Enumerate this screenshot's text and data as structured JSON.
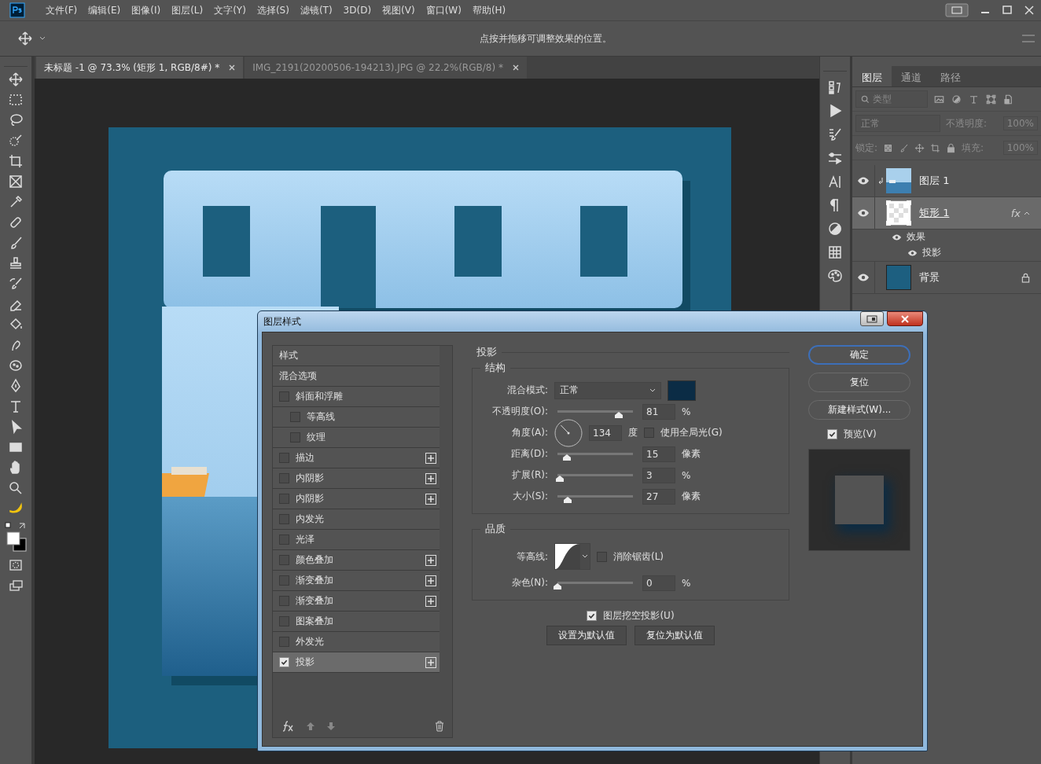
{
  "menu_bar": {
    "items": [
      "文件(F)",
      "编辑(E)",
      "图像(I)",
      "图层(L)",
      "文字(Y)",
      "选择(S)",
      "滤镜(T)",
      "3D(D)",
      "视图(V)",
      "窗口(W)",
      "帮助(H)"
    ]
  },
  "options_bar": {
    "hint": "点按并拖移可调整效果的位置。"
  },
  "document_tabs": [
    {
      "label": "未标题 -1 @ 73.3% (矩形 1, RGB/8#) *",
      "selected": true
    },
    {
      "label": "IMG_2191(20200506-194213).JPG @ 22.2%(RGB/8) *",
      "selected": false
    }
  ],
  "layers_panel": {
    "tabs": [
      {
        "label": "图层",
        "selected": true
      },
      {
        "label": "通道",
        "selected": false
      },
      {
        "label": "路径",
        "selected": false
      }
    ],
    "filter": "类型",
    "blend_mode": "正常",
    "opacity_label": "不透明度:",
    "opacity": "100%",
    "lock_label": "锁定:",
    "fill_label": "填充:",
    "fill": "100%",
    "layers": [
      {
        "name": "图层 1",
        "visible": true,
        "selected": false,
        "clipped": true,
        "locked": false
      },
      {
        "name": "矩形 1",
        "kind": "shape",
        "visible": true,
        "selected": true,
        "clipped": false,
        "locked": false,
        "fx": "fx",
        "effects": {
          "label": "效果",
          "items": [
            "投影"
          ]
        }
      },
      {
        "name": "背景",
        "kind": "solid",
        "visible": true,
        "selected": false,
        "clipped": false,
        "locked": true
      }
    ]
  },
  "layer_style_dialog": {
    "title": "图层样式",
    "styles": [
      {
        "label": "样式",
        "kind": "header",
        "selected": false
      },
      {
        "label": "混合选项",
        "kind": "header",
        "selected": false
      },
      {
        "label": "斜面和浮雕",
        "kind": "checkbox",
        "checked": false,
        "selected": false,
        "addable": false,
        "children": [
          {
            "label": "等高线",
            "kind": "checkbox",
            "checked": false,
            "selected": false,
            "addable": false
          },
          {
            "label": "纹理",
            "kind": "checkbox",
            "checked": false,
            "selected": false,
            "addable": false
          }
        ]
      },
      {
        "label": "描边",
        "kind": "checkbox",
        "checked": false,
        "selected": false,
        "addable": true
      },
      {
        "label": "内阴影",
        "kind": "checkbox",
        "checked": false,
        "selected": false,
        "addable": true
      },
      {
        "label": "内阴影",
        "kind": "checkbox",
        "checked": false,
        "selected": false,
        "addable": true
      },
      {
        "label": "内发光",
        "kind": "checkbox",
        "checked": false,
        "selected": false,
        "addable": false
      },
      {
        "label": "光泽",
        "kind": "checkbox",
        "checked": false,
        "selected": false,
        "addable": false
      },
      {
        "label": "颜色叠加",
        "kind": "checkbox",
        "checked": false,
        "selected": false,
        "addable": true
      },
      {
        "label": "渐变叠加",
        "kind": "checkbox",
        "checked": false,
        "selected": false,
        "addable": true
      },
      {
        "label": "渐变叠加",
        "kind": "checkbox",
        "checked": false,
        "selected": false,
        "addable": true
      },
      {
        "label": "图案叠加",
        "kind": "checkbox",
        "checked": false,
        "selected": false,
        "addable": false
      },
      {
        "label": "外发光",
        "kind": "checkbox",
        "checked": false,
        "selected": false,
        "addable": false
      },
      {
        "label": "投影",
        "kind": "checkbox",
        "checked": true,
        "selected": true,
        "addable": true
      }
    ],
    "section_title": "投影",
    "structure": {
      "title": "结构",
      "blend_mode_label": "混合模式:",
      "blend_mode": "正常",
      "color": "#0b2c45",
      "rows": [
        {
          "kind": "slider",
          "label": "不透明度(O):",
          "level": 0.81,
          "value": "81",
          "unit": "%"
        },
        {
          "kind": "angle",
          "label": "角度(A):",
          "value": "134",
          "unit": "度",
          "option": {
            "label": "使用全局光(G)",
            "checked": false
          }
        },
        {
          "kind": "slider",
          "label": "距离(D):",
          "level": 0.13,
          "value": "15",
          "unit": "像素"
        },
        {
          "kind": "slider",
          "label": "扩展(R):",
          "level": 0.03,
          "value": "3",
          "unit": "%"
        },
        {
          "kind": "slider",
          "label": "大小(S):",
          "level": 0.14,
          "value": "27",
          "unit": "像素"
        }
      ]
    },
    "quality": {
      "title": "品质",
      "contour_label": "等高线:",
      "antialias": {
        "label": "消除锯齿(L)",
        "checked": false
      },
      "noise": {
        "label": "杂色(N):",
        "level": 0,
        "value": "0",
        "unit": "%"
      }
    },
    "knockout": {
      "label": "图层挖空投影(U)",
      "checked": true
    },
    "default_buttons": [
      "设置为默认值",
      "复位为默认值"
    ],
    "buttons": [
      {
        "label": "确定",
        "default": true
      },
      {
        "label": "复位",
        "default": false
      },
      {
        "label": "新建样式(W)...",
        "default": false
      }
    ],
    "preview": {
      "label": "预览(V)",
      "checked": true
    }
  }
}
